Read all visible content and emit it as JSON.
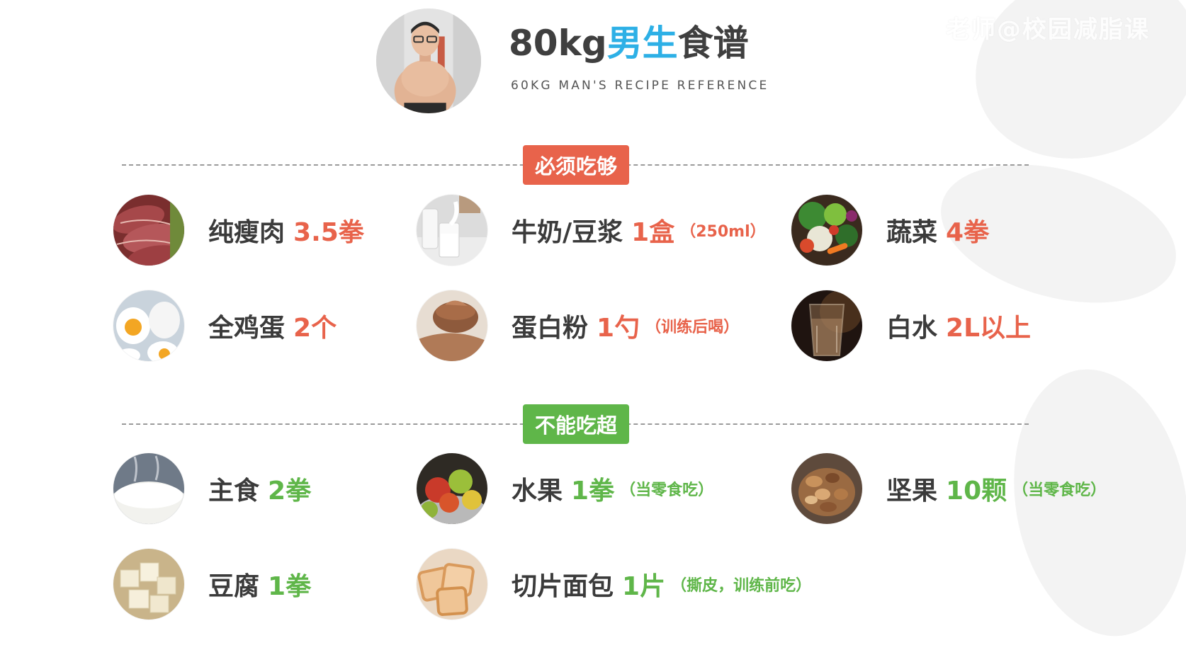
{
  "header": {
    "title_prefix": "80kg",
    "title_accent": "男生",
    "title_suffix": "食谱",
    "subtitle": "60KG MAN'S RECIPE REFERENCE",
    "accent_color": "#2db0e6"
  },
  "watermark": "老师@校园减脂课",
  "sections": {
    "must_eat": {
      "badge": "必须吃够",
      "color": "#e8634b",
      "items": [
        {
          "label": "纯瘦肉",
          "amount": "3.5拳",
          "note": "",
          "icon": "lean-meat"
        },
        {
          "label": "牛奶/豆浆",
          "amount": "1盒",
          "note": "（250ml）",
          "icon": "milk"
        },
        {
          "label": "蔬菜",
          "amount": "4拳",
          "note": "",
          "icon": "vegetables"
        },
        {
          "label": "全鸡蛋",
          "amount": "2个",
          "note": "",
          "icon": "eggs"
        },
        {
          "label": "蛋白粉",
          "amount": "1勺",
          "note": "（训练后喝）",
          "icon": "protein-powder"
        },
        {
          "label": "白水",
          "amount": "2L以上",
          "note": "",
          "icon": "water"
        }
      ]
    },
    "limit": {
      "badge": "不能吃超",
      "color": "#5fb649",
      "items": [
        {
          "label": "主食",
          "amount": "2拳",
          "note": "",
          "icon": "rice"
        },
        {
          "label": "水果",
          "amount": "1拳",
          "note": "（当零食吃）",
          "icon": "fruit"
        },
        {
          "label": "坚果",
          "amount": "10颗",
          "note": "（当零食吃）",
          "icon": "nuts"
        },
        {
          "label": "豆腐",
          "amount": "1拳",
          "note": "",
          "icon": "tofu"
        },
        {
          "label": "切片面包",
          "amount": "1片",
          "note": "（撕皮，训练前吃）",
          "icon": "bread"
        }
      ]
    }
  }
}
